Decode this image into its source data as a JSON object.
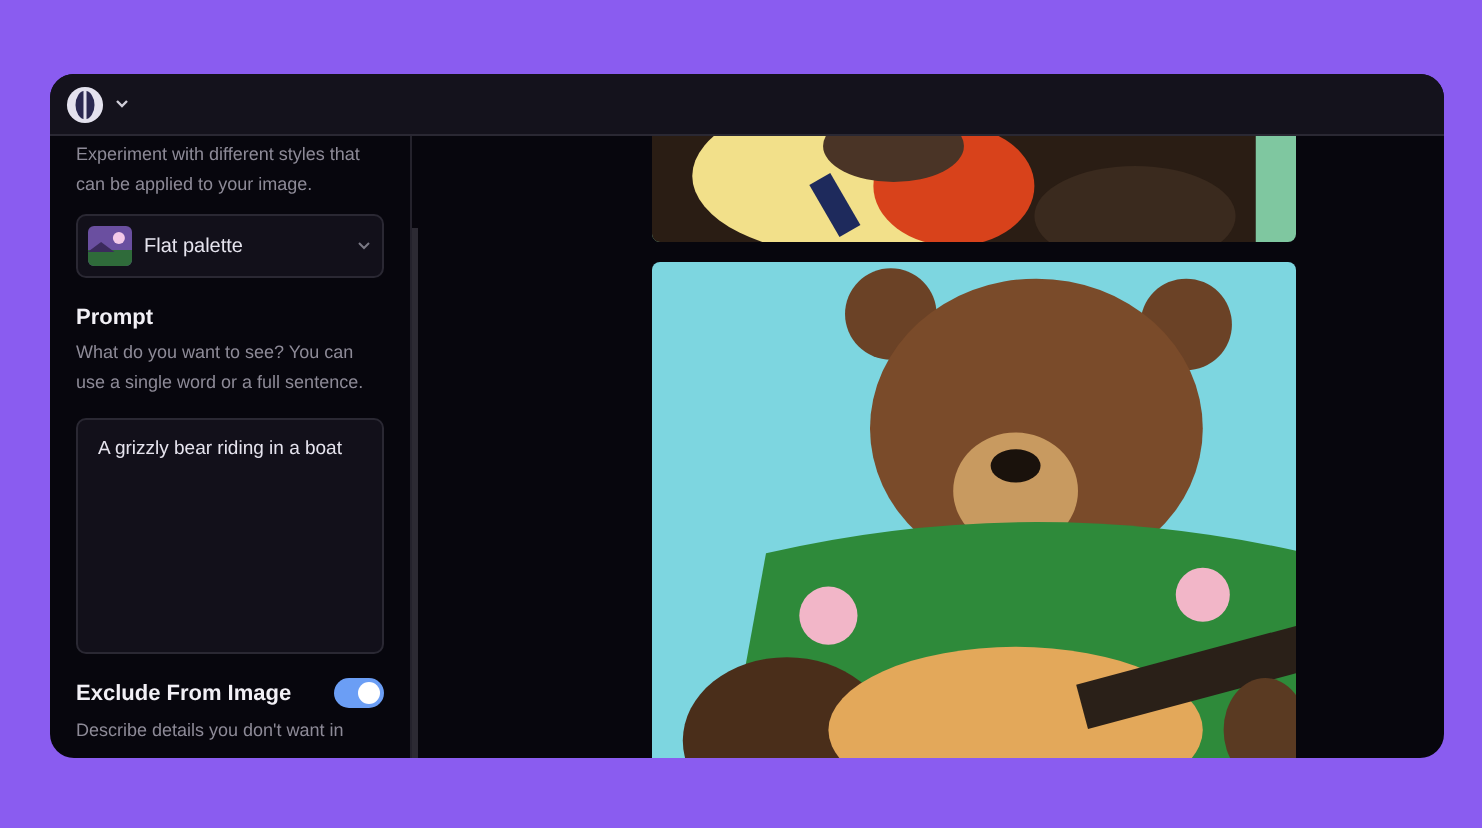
{
  "styles": {
    "description": "Experiment with different styles that can be applied to your image.",
    "select": {
      "value": "Flat palette"
    }
  },
  "prompt": {
    "title": "Prompt",
    "description": "What do you want to see? You can use a single word or a full sentence.",
    "value": "A grizzly bear riding in a boat"
  },
  "exclude": {
    "title": "Exclude From Image",
    "on": true,
    "description": "Describe details you don't want in"
  }
}
